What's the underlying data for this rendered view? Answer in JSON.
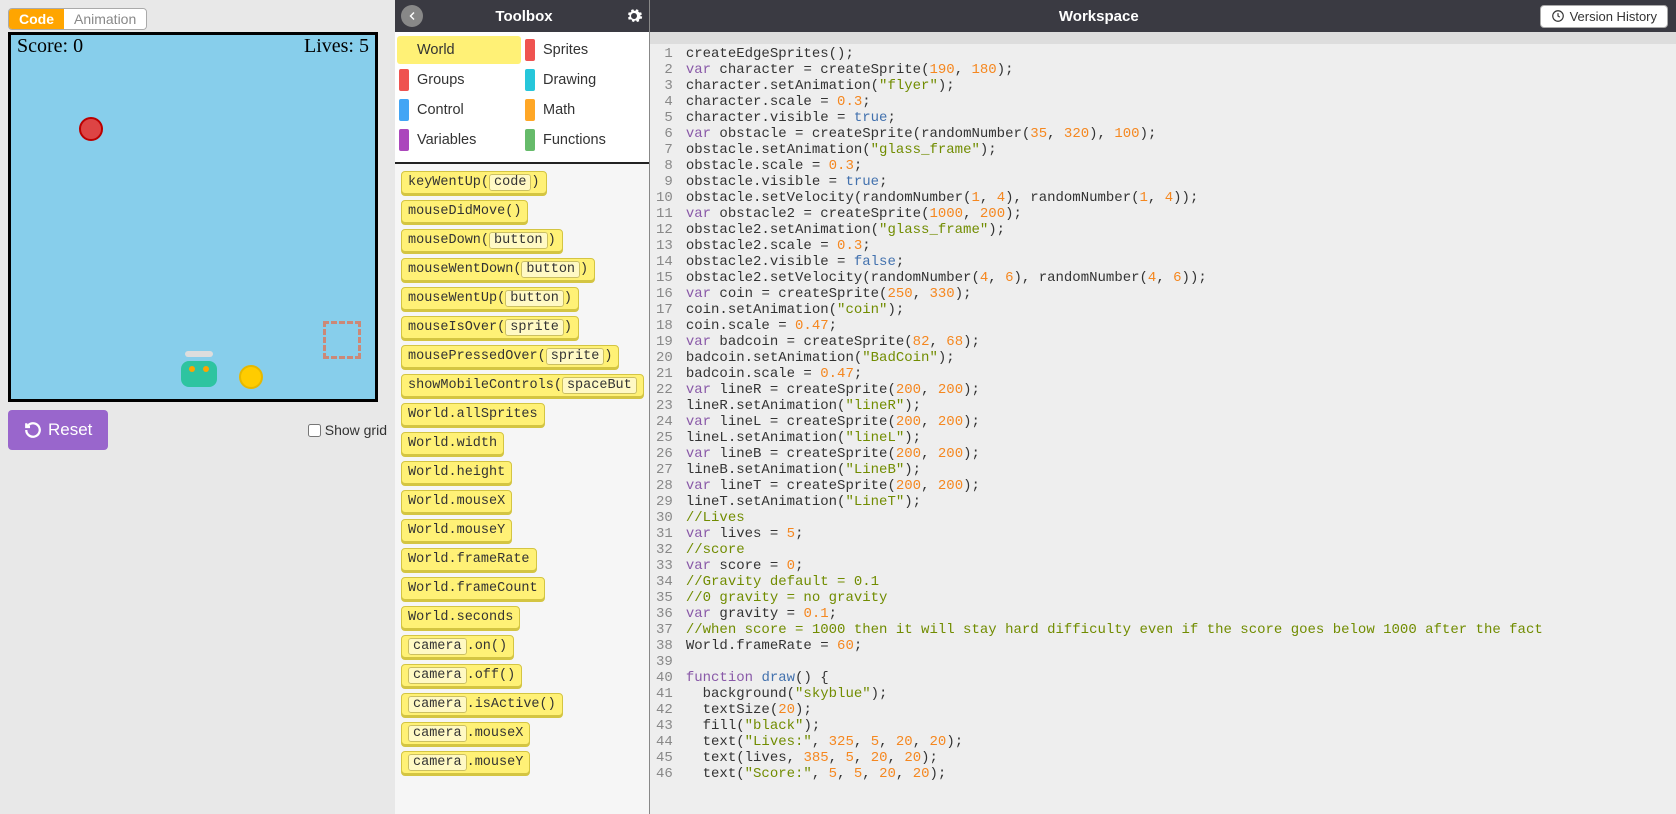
{
  "tabs": {
    "code": "Code",
    "animation": "Animation"
  },
  "game": {
    "score_label": "Score: 0",
    "lives_label": "Lives: 5"
  },
  "reset_label": "Reset",
  "showgrid_label": "Show grid",
  "toolbox": {
    "title": "Toolbox",
    "categories": [
      {
        "name": "World",
        "color": "#fff176",
        "selected": true
      },
      {
        "name": "Sprites",
        "color": "#ef5350"
      },
      {
        "name": "Groups",
        "color": "#ef5350"
      },
      {
        "name": "Drawing",
        "color": "#26c6da"
      },
      {
        "name": "Control",
        "color": "#42a5f5"
      },
      {
        "name": "Math",
        "color": "#ffa726"
      },
      {
        "name": "Variables",
        "color": "#ab47bc"
      },
      {
        "name": "Functions",
        "color": "#66bb6a"
      }
    ],
    "blocks": [
      {
        "pre": "keyWentUp(",
        "sub": "code",
        "post": ")"
      },
      {
        "pre": "mouseDidMove()"
      },
      {
        "pre": "mouseDown(",
        "sub": "button",
        "post": ")"
      },
      {
        "pre": "mouseWentDown(",
        "sub": "button",
        "post": ")"
      },
      {
        "pre": "mouseWentUp(",
        "sub": "button",
        "post": ")"
      },
      {
        "pre": "mouseIsOver(",
        "sub": "sprite",
        "post": ")"
      },
      {
        "pre": "mousePressedOver(",
        "sub": "sprite",
        "post": ")"
      },
      {
        "pre": "showMobileControls(",
        "sub": "spaceBut",
        "post": ""
      },
      {
        "pre": "World.allSprites"
      },
      {
        "pre": "World.width"
      },
      {
        "pre": "World.height"
      },
      {
        "pre": "World.mouseX"
      },
      {
        "pre": "World.mouseY"
      },
      {
        "pre": "World.frameRate"
      },
      {
        "pre": "World.frameCount"
      },
      {
        "pre": "World.seconds"
      },
      {
        "pre2": "camera",
        "post": ".on()"
      },
      {
        "pre2": "camera",
        "post": ".off()"
      },
      {
        "pre2": "camera",
        "post": ".isActive()"
      },
      {
        "pre2": "camera",
        "post": ".mouseX"
      },
      {
        "pre2": "camera",
        "post": ".mouseY"
      }
    ]
  },
  "workspace": {
    "title": "Workspace",
    "version_label": "Version History",
    "code_lines": [
      {
        "n": 1,
        "t": [
          [
            "id",
            "createEdgeSprites();"
          ]
        ]
      },
      {
        "n": 2,
        "t": [
          [
            "kw",
            "var"
          ],
          [
            "id",
            " character = createSprite("
          ],
          [
            "num",
            "190"
          ],
          [
            "id",
            ", "
          ],
          [
            "num",
            "180"
          ],
          [
            "id",
            ");"
          ]
        ]
      },
      {
        "n": 3,
        "t": [
          [
            "id",
            "character.setAnimation("
          ],
          [
            "str",
            "\"flyer\""
          ],
          [
            "id",
            ");"
          ]
        ]
      },
      {
        "n": 4,
        "t": [
          [
            "id",
            "character.scale = "
          ],
          [
            "num",
            "0.3"
          ],
          [
            "id",
            ";"
          ]
        ]
      },
      {
        "n": 5,
        "t": [
          [
            "id",
            "character.visible = "
          ],
          [
            "bool",
            "true"
          ],
          [
            "id",
            ";"
          ]
        ]
      },
      {
        "n": 6,
        "t": [
          [
            "kw",
            "var"
          ],
          [
            "id",
            " obstacle = createSprite(randomNumber("
          ],
          [
            "num",
            "35"
          ],
          [
            "id",
            ", "
          ],
          [
            "num",
            "320"
          ],
          [
            "id",
            "), "
          ],
          [
            "num",
            "100"
          ],
          [
            "id",
            ");"
          ]
        ]
      },
      {
        "n": 7,
        "t": [
          [
            "id",
            "obstacle.setAnimation("
          ],
          [
            "str",
            "\"glass_frame\""
          ],
          [
            "id",
            ");"
          ]
        ]
      },
      {
        "n": 8,
        "t": [
          [
            "id",
            "obstacle.scale = "
          ],
          [
            "num",
            "0.3"
          ],
          [
            "id",
            ";"
          ]
        ]
      },
      {
        "n": 9,
        "t": [
          [
            "id",
            "obstacle.visible = "
          ],
          [
            "bool",
            "true"
          ],
          [
            "id",
            ";"
          ]
        ]
      },
      {
        "n": 10,
        "t": [
          [
            "id",
            "obstacle.setVelocity(randomNumber("
          ],
          [
            "num",
            "1"
          ],
          [
            "id",
            ", "
          ],
          [
            "num",
            "4"
          ],
          [
            "id",
            "), randomNumber("
          ],
          [
            "num",
            "1"
          ],
          [
            "id",
            ", "
          ],
          [
            "num",
            "4"
          ],
          [
            "id",
            "));"
          ]
        ]
      },
      {
        "n": 11,
        "t": [
          [
            "kw",
            "var"
          ],
          [
            "id",
            " obstacle2 = createSprite("
          ],
          [
            "num",
            "1000"
          ],
          [
            "id",
            ", "
          ],
          [
            "num",
            "200"
          ],
          [
            "id",
            ");"
          ]
        ]
      },
      {
        "n": 12,
        "t": [
          [
            "id",
            "obstacle2.setAnimation("
          ],
          [
            "str",
            "\"glass_frame\""
          ],
          [
            "id",
            ");"
          ]
        ]
      },
      {
        "n": 13,
        "t": [
          [
            "id",
            "obstacle2.scale = "
          ],
          [
            "num",
            "0.3"
          ],
          [
            "id",
            ";"
          ]
        ]
      },
      {
        "n": 14,
        "t": [
          [
            "id",
            "obstacle2.visible = "
          ],
          [
            "bool",
            "false"
          ],
          [
            "id",
            ";"
          ]
        ]
      },
      {
        "n": 15,
        "t": [
          [
            "id",
            "obstacle2.setVelocity(randomNumber("
          ],
          [
            "num",
            "4"
          ],
          [
            "id",
            ", "
          ],
          [
            "num",
            "6"
          ],
          [
            "id",
            "), randomNumber("
          ],
          [
            "num",
            "4"
          ],
          [
            "id",
            ", "
          ],
          [
            "num",
            "6"
          ],
          [
            "id",
            "));"
          ]
        ]
      },
      {
        "n": 16,
        "t": [
          [
            "kw",
            "var"
          ],
          [
            "id",
            " coin = createSprite("
          ],
          [
            "num",
            "250"
          ],
          [
            "id",
            ", "
          ],
          [
            "num",
            "330"
          ],
          [
            "id",
            ");"
          ]
        ]
      },
      {
        "n": 17,
        "t": [
          [
            "id",
            "coin.setAnimation("
          ],
          [
            "str",
            "\"coin\""
          ],
          [
            "id",
            ");"
          ]
        ]
      },
      {
        "n": 18,
        "t": [
          [
            "id",
            "coin.scale = "
          ],
          [
            "num",
            "0.47"
          ],
          [
            "id",
            ";"
          ]
        ]
      },
      {
        "n": 19,
        "t": [
          [
            "kw",
            "var"
          ],
          [
            "id",
            " badcoin = createSprite("
          ],
          [
            "num",
            "82"
          ],
          [
            "id",
            ", "
          ],
          [
            "num",
            "68"
          ],
          [
            "id",
            ");"
          ]
        ]
      },
      {
        "n": 20,
        "t": [
          [
            "id",
            "badcoin.setAnimation("
          ],
          [
            "str",
            "\"BadCoin\""
          ],
          [
            "id",
            ");"
          ]
        ]
      },
      {
        "n": 21,
        "t": [
          [
            "id",
            "badcoin.scale = "
          ],
          [
            "num",
            "0.47"
          ],
          [
            "id",
            ";"
          ]
        ]
      },
      {
        "n": 22,
        "t": [
          [
            "kw",
            "var"
          ],
          [
            "id",
            " lineR = createSprite("
          ],
          [
            "num",
            "200"
          ],
          [
            "id",
            ", "
          ],
          [
            "num",
            "200"
          ],
          [
            "id",
            ");"
          ]
        ]
      },
      {
        "n": 23,
        "t": [
          [
            "id",
            "lineR.setAnimation("
          ],
          [
            "str",
            "\"lineR\""
          ],
          [
            "id",
            ");"
          ]
        ]
      },
      {
        "n": 24,
        "t": [
          [
            "kw",
            "var"
          ],
          [
            "id",
            " lineL = createSprite("
          ],
          [
            "num",
            "200"
          ],
          [
            "id",
            ", "
          ],
          [
            "num",
            "200"
          ],
          [
            "id",
            ");"
          ]
        ]
      },
      {
        "n": 25,
        "t": [
          [
            "id",
            "lineL.setAnimation("
          ],
          [
            "str",
            "\"lineL\""
          ],
          [
            "id",
            ");"
          ]
        ]
      },
      {
        "n": 26,
        "t": [
          [
            "kw",
            "var"
          ],
          [
            "id",
            " lineB = createSprite("
          ],
          [
            "num",
            "200"
          ],
          [
            "id",
            ", "
          ],
          [
            "num",
            "200"
          ],
          [
            "id",
            ");"
          ]
        ]
      },
      {
        "n": 27,
        "t": [
          [
            "id",
            "lineB.setAnimation("
          ],
          [
            "str",
            "\"LineB\""
          ],
          [
            "id",
            ");"
          ]
        ]
      },
      {
        "n": 28,
        "t": [
          [
            "kw",
            "var"
          ],
          [
            "id",
            " lineT = createSprite("
          ],
          [
            "num",
            "200"
          ],
          [
            "id",
            ", "
          ],
          [
            "num",
            "200"
          ],
          [
            "id",
            ");"
          ]
        ]
      },
      {
        "n": 29,
        "t": [
          [
            "id",
            "lineT.setAnimation("
          ],
          [
            "str",
            "\"LineT\""
          ],
          [
            "id",
            ");"
          ]
        ]
      },
      {
        "n": 30,
        "t": [
          [
            "com",
            "//Lives"
          ]
        ]
      },
      {
        "n": 31,
        "t": [
          [
            "kw",
            "var"
          ],
          [
            "id",
            " lives = "
          ],
          [
            "num",
            "5"
          ],
          [
            "id",
            ";"
          ]
        ]
      },
      {
        "n": 32,
        "t": [
          [
            "com",
            "//score"
          ]
        ]
      },
      {
        "n": 33,
        "t": [
          [
            "kw",
            "var"
          ],
          [
            "id",
            " score = "
          ],
          [
            "num",
            "0"
          ],
          [
            "id",
            ";"
          ]
        ]
      },
      {
        "n": 34,
        "t": [
          [
            "com",
            "//Gravity default = 0.1"
          ]
        ]
      },
      {
        "n": 35,
        "t": [
          [
            "com",
            "//0 gravity = no gravity"
          ]
        ]
      },
      {
        "n": 36,
        "t": [
          [
            "kw",
            "var"
          ],
          [
            "id",
            " gravity = "
          ],
          [
            "num",
            "0.1"
          ],
          [
            "id",
            ";"
          ]
        ]
      },
      {
        "n": 37,
        "t": [
          [
            "com",
            "//when score = 1000 then it will stay hard difficulty even if the score goes below 1000 after the fact"
          ]
        ]
      },
      {
        "n": 38,
        "t": [
          [
            "id",
            "World.frameRate = "
          ],
          [
            "num",
            "60"
          ],
          [
            "id",
            ";"
          ]
        ]
      },
      {
        "n": 39,
        "t": [
          [
            "id",
            ""
          ]
        ]
      },
      {
        "n": 40,
        "fold": true,
        "t": [
          [
            "kw",
            "function"
          ],
          [
            "id",
            " "
          ],
          [
            "bool",
            "draw"
          ],
          [
            "id",
            "() {"
          ]
        ]
      },
      {
        "n": 41,
        "t": [
          [
            "id",
            "  background("
          ],
          [
            "str",
            "\"skyblue\""
          ],
          [
            "id",
            ");"
          ]
        ]
      },
      {
        "n": 42,
        "t": [
          [
            "id",
            "  textSize("
          ],
          [
            "num",
            "20"
          ],
          [
            "id",
            ");"
          ]
        ]
      },
      {
        "n": 43,
        "t": [
          [
            "id",
            "  fill("
          ],
          [
            "str",
            "\"black\""
          ],
          [
            "id",
            ");"
          ]
        ]
      },
      {
        "n": 44,
        "t": [
          [
            "id",
            "  text("
          ],
          [
            "str",
            "\"Lives:\""
          ],
          [
            "id",
            ", "
          ],
          [
            "num",
            "325"
          ],
          [
            "id",
            ", "
          ],
          [
            "num",
            "5"
          ],
          [
            "id",
            ", "
          ],
          [
            "num",
            "20"
          ],
          [
            "id",
            ", "
          ],
          [
            "num",
            "20"
          ],
          [
            "id",
            ");"
          ]
        ]
      },
      {
        "n": 45,
        "t": [
          [
            "id",
            "  text(lives, "
          ],
          [
            "num",
            "385"
          ],
          [
            "id",
            ", "
          ],
          [
            "num",
            "5"
          ],
          [
            "id",
            ", "
          ],
          [
            "num",
            "20"
          ],
          [
            "id",
            ", "
          ],
          [
            "num",
            "20"
          ],
          [
            "id",
            ");"
          ]
        ]
      },
      {
        "n": 46,
        "t": [
          [
            "id",
            "  text("
          ],
          [
            "str",
            "\"Score:\""
          ],
          [
            "id",
            ", "
          ],
          [
            "num",
            "5"
          ],
          [
            "id",
            ", "
          ],
          [
            "num",
            "5"
          ],
          [
            "id",
            ", "
          ],
          [
            "num",
            "20"
          ],
          [
            "id",
            ", "
          ],
          [
            "num",
            "20"
          ],
          [
            "id",
            ");"
          ]
        ]
      }
    ]
  }
}
